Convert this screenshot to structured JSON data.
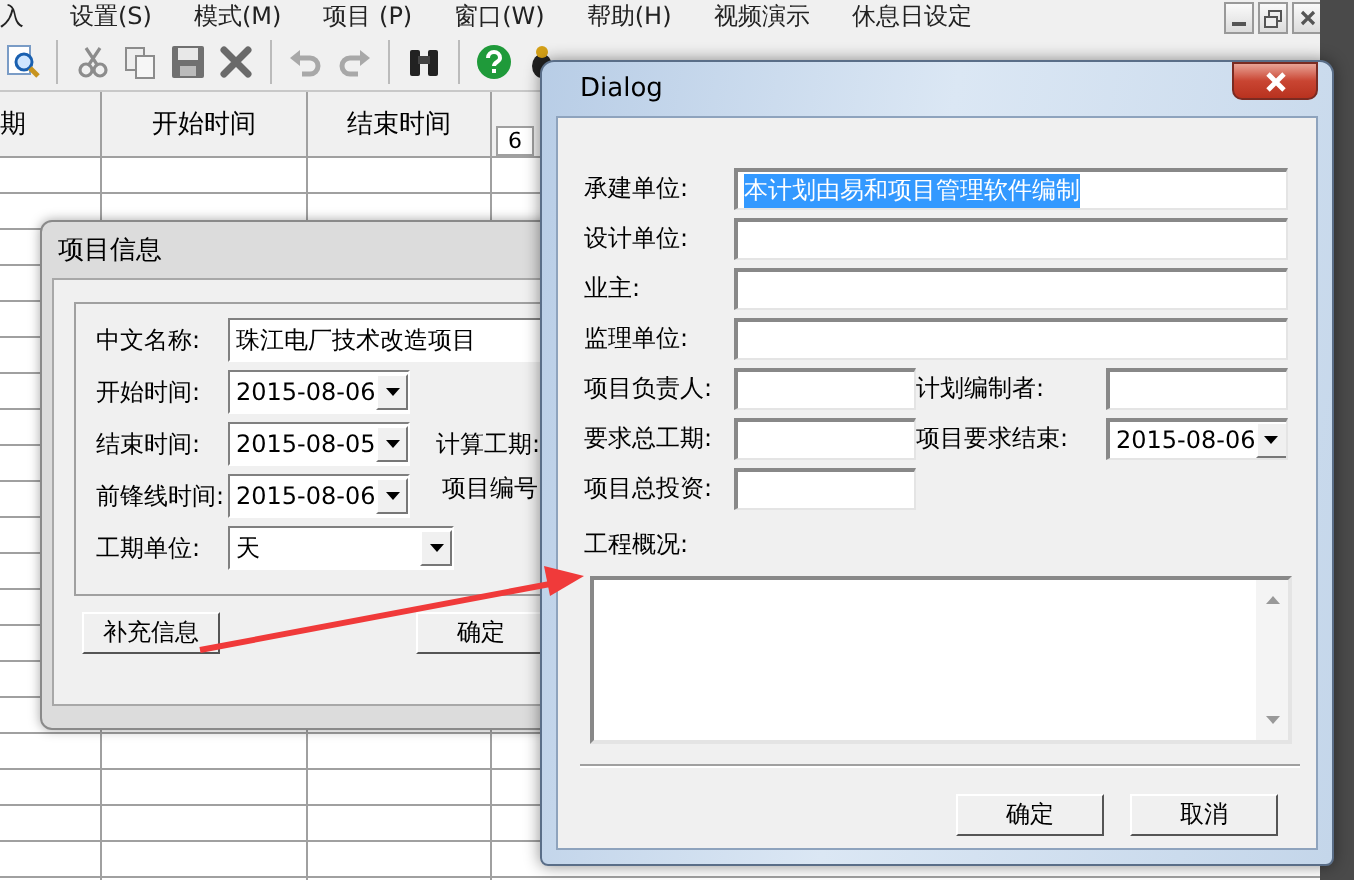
{
  "app": {
    "menu": [
      {
        "label": "入"
      },
      {
        "label": "设置(S)"
      },
      {
        "label": "模式(M)"
      },
      {
        "label": "项目 (P)"
      },
      {
        "label": "窗口(W)"
      },
      {
        "label": "帮助(H)"
      },
      {
        "label": "视频演示"
      },
      {
        "label": "休息日设定"
      }
    ],
    "table": {
      "columns": [
        "期",
        "开始时间",
        "结束时间"
      ]
    },
    "gantt_header": "6"
  },
  "project_info": {
    "title": "项目信息",
    "fields": [
      {
        "label": "中文名称:",
        "kind": "text",
        "value": "珠江电厂技术改造项目"
      },
      {
        "label": "开始时间:",
        "kind": "date",
        "value": "2015-08-06"
      },
      {
        "label": "结束时间:",
        "kind": "date",
        "value": "2015-08-05"
      },
      {
        "label": "前锋线时间:",
        "kind": "date",
        "value": "2015-08-06"
      },
      {
        "label": "工期单位:",
        "kind": "combo",
        "value": "天"
      }
    ],
    "side_labels": [
      "计算工期:",
      "项目编号"
    ],
    "buttons": [
      "补充信息",
      "确定"
    ]
  },
  "dialog": {
    "title": "Dialog",
    "rows": [
      [
        {
          "label": "承建单位:",
          "kind": "wide_text",
          "value": "本计划由易和项目管理软件编制",
          "text_selected": true
        }
      ],
      [
        {
          "label": "设计单位:",
          "kind": "wide_text"
        }
      ],
      [
        {
          "label": "业主:",
          "kind": "wide_text"
        }
      ],
      [
        {
          "label": "监理单位:",
          "kind": "wide_text"
        }
      ],
      [
        {
          "label": "项目负责人:",
          "kind": "text"
        },
        {
          "label": "计划编制者:",
          "kind": "text"
        }
      ],
      [
        {
          "label": "要求总工期:",
          "kind": "text"
        },
        {
          "label": "项目要求结束:",
          "kind": "date",
          "value": "2015-08-06",
          "text_selected": false
        }
      ],
      [
        {
          "label": "项目总投资:",
          "kind": "text"
        }
      ]
    ],
    "overview_label": "工程概况:",
    "buttons": [
      "确定",
      "取消"
    ]
  }
}
